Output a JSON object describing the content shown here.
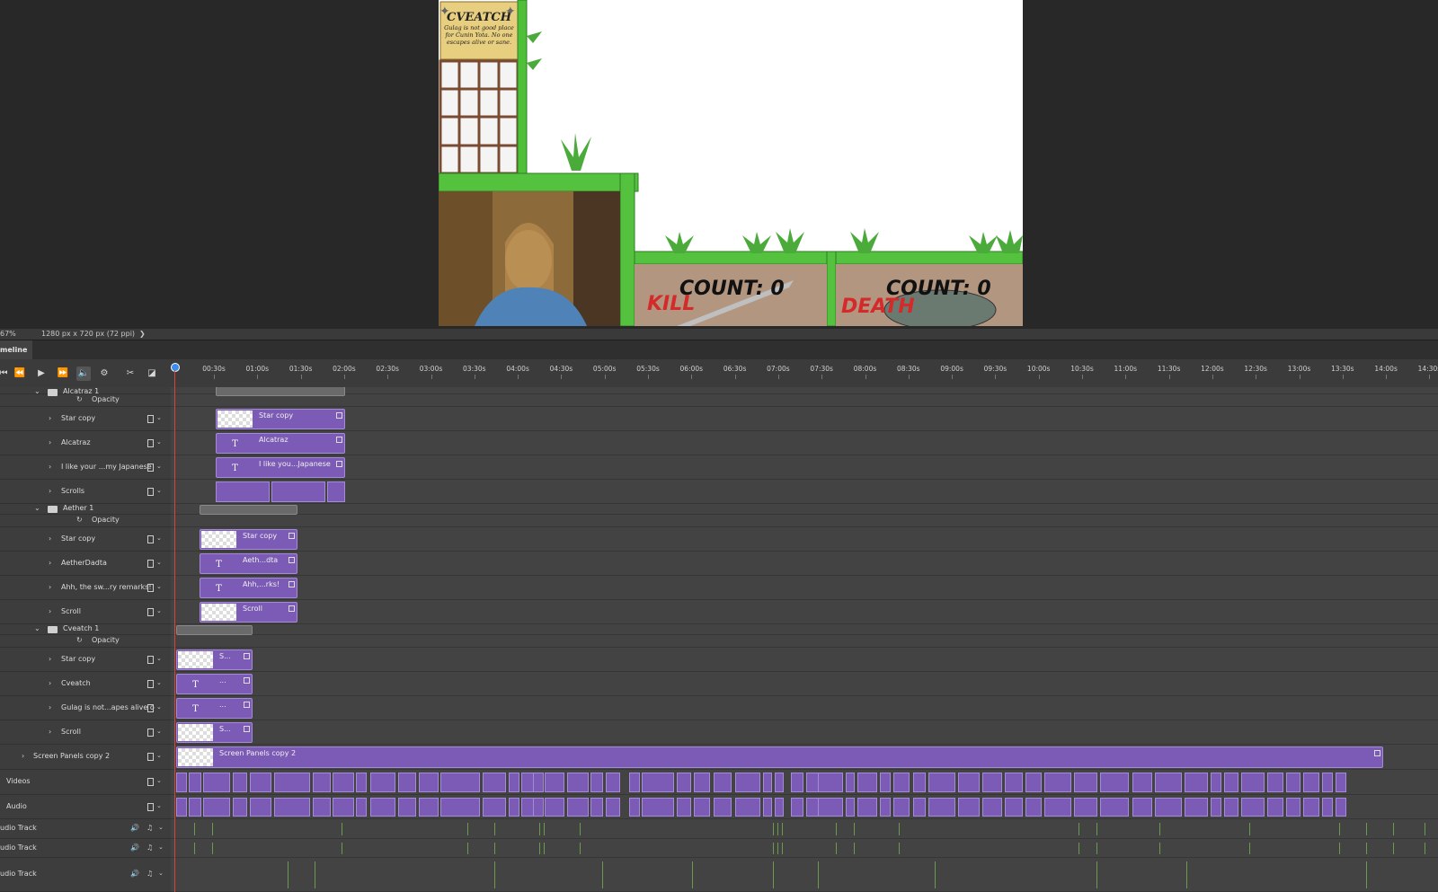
{
  "status": {
    "zoom": "67%",
    "doc_info": "1280 px x 720 px (72 ppi)",
    "arrow": "❯"
  },
  "panel": {
    "title": "meline"
  },
  "overlay": {
    "cveatch_title": "CVEATCH",
    "cveatch_text": "Gulag is not good place for Cunin Yota. No one escapes alive or sane.",
    "kill_label": "KILL",
    "kill_count": "COUNT: 0",
    "death_label": "DEATH",
    "death_count": "COUNT: 0"
  },
  "ruler_ticks": [
    "00:30s",
    "01:00s",
    "01:30s",
    "02:00s",
    "02:30s",
    "03:00s",
    "03:30s",
    "04:00s",
    "04:30s",
    "05:00s",
    "05:30s",
    "06:00s",
    "06:30s",
    "07:00s",
    "07:30s",
    "08:00s",
    "08:30s",
    "09:00s",
    "09:30s",
    "10:00s",
    "10:30s",
    "11:00s",
    "11:30s",
    "12:00s",
    "12:30s",
    "13:00s",
    "13:30s",
    "14:00s",
    "14:30s"
  ],
  "layers": [
    {
      "name": "Alcatraz 1",
      "kind": "group"
    },
    {
      "name": "Opacity",
      "kind": "prop"
    },
    {
      "name": "Star copy",
      "kind": "layer"
    },
    {
      "name": "Alcatraz",
      "kind": "layer"
    },
    {
      "name": "I like your ...my Japanese",
      "kind": "layer"
    },
    {
      "name": "Scrolls",
      "kind": "layer"
    },
    {
      "name": "Aether 1",
      "kind": "group"
    },
    {
      "name": "Opacity",
      "kind": "prop"
    },
    {
      "name": "Star copy",
      "kind": "layer"
    },
    {
      "name": "AetherDadta",
      "kind": "layer"
    },
    {
      "name": "Ahh, the sw...ry remarks!",
      "kind": "layer"
    },
    {
      "name": "Scroll",
      "kind": "layer"
    },
    {
      "name": "Cveatch 1",
      "kind": "group"
    },
    {
      "name": "Opacity",
      "kind": "prop"
    },
    {
      "name": "Star copy",
      "kind": "layer"
    },
    {
      "name": "Cveatch",
      "kind": "layer"
    },
    {
      "name": "Gulag is not...apes alive o",
      "kind": "layer"
    },
    {
      "name": "Scroll",
      "kind": "layer"
    },
    {
      "name": "Screen Panels copy 2",
      "kind": "top"
    },
    {
      "name": "Videos",
      "kind": "video"
    },
    {
      "name": "Audio",
      "kind": "video"
    },
    {
      "name": "udio Track",
      "kind": "audio"
    },
    {
      "name": "udio Track",
      "kind": "audio"
    },
    {
      "name": "udio Track",
      "kind": "audio"
    }
  ],
  "clips": {
    "star_copy_1": "Star copy",
    "alcatraz": "Alcatraz",
    "japanese": "I like you...Japanese",
    "star_copy_2": "Star copy",
    "aether": "Aeth...dta",
    "ahh": "Ahh,...rks!",
    "scroll_2": "Scroll",
    "star_copy_3": "S...",
    "cveatch": "...",
    "gulag": "...",
    "scroll_3": "S...",
    "screen_panels": "Screen Panels copy 2"
  },
  "icons": {
    "loop": "↻",
    "text_layer": "T",
    "expand": "›",
    "collapse": "⌄",
    "folder": "folder-icon",
    "speaker": "🔊",
    "note": "♫"
  }
}
